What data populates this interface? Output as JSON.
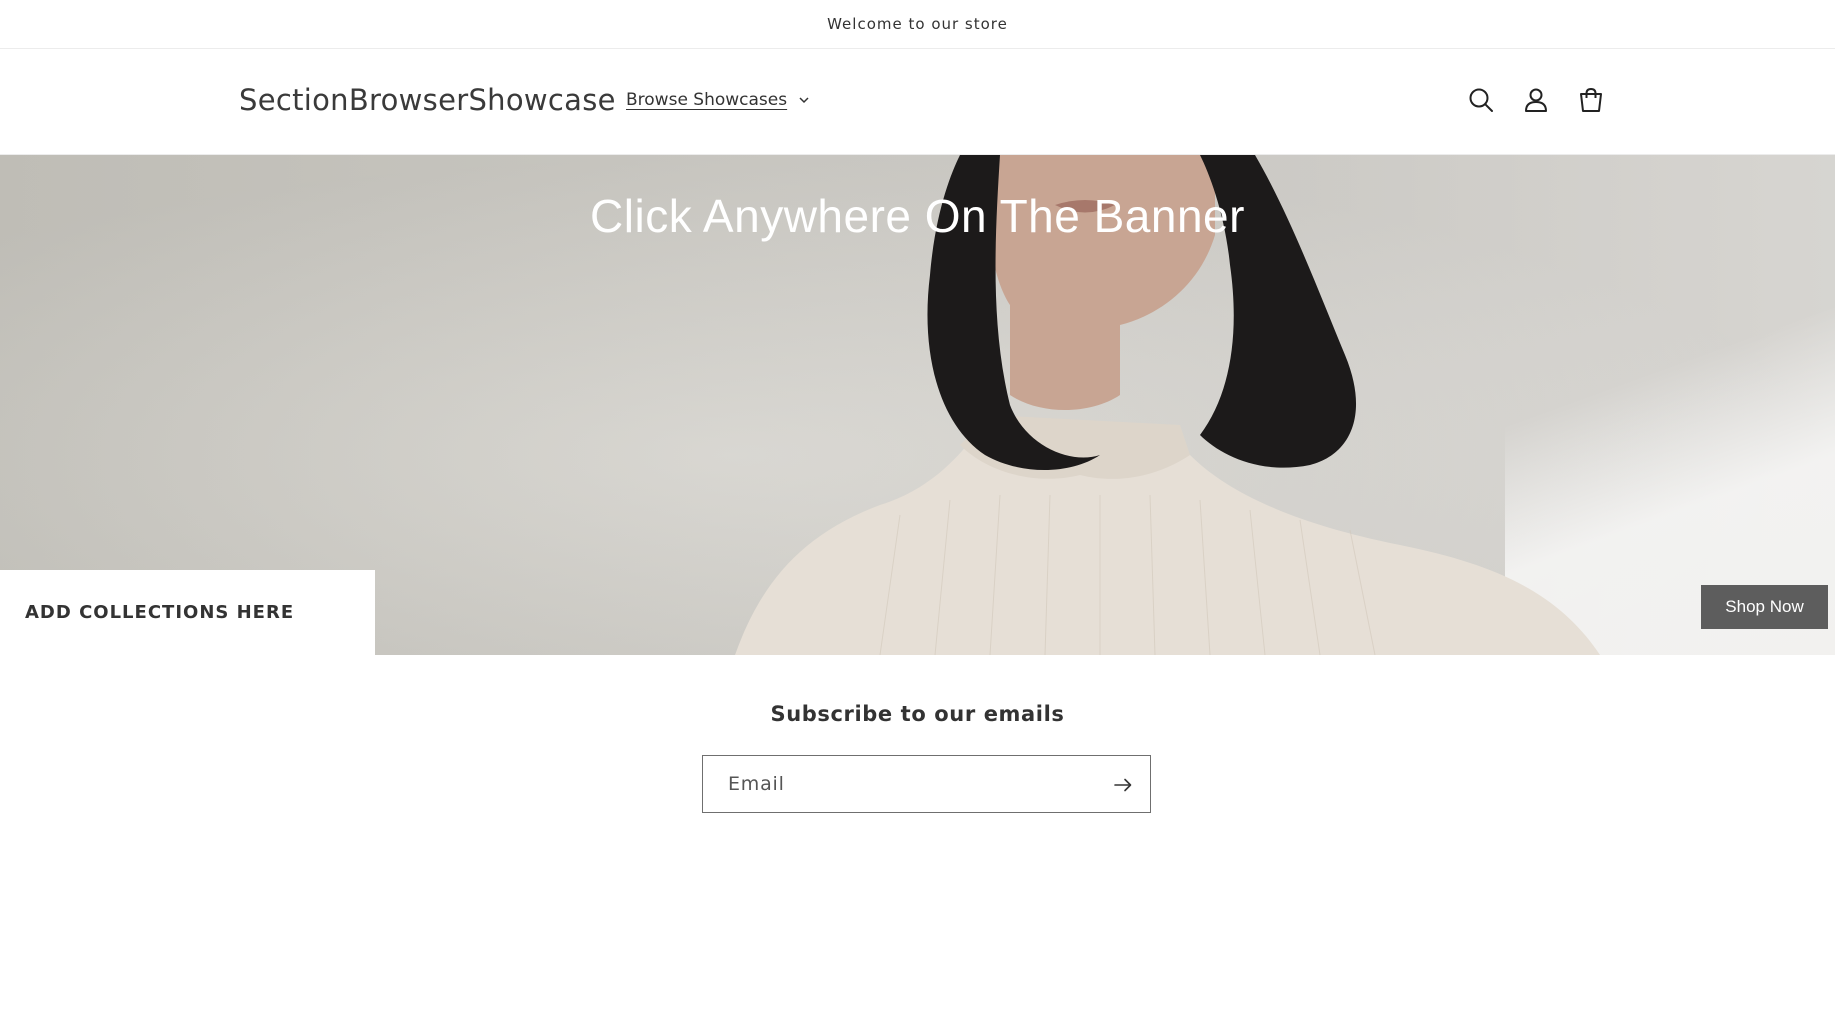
{
  "announcement": {
    "text": "Welcome to our store"
  },
  "header": {
    "logo": "SectionBrowserShowcase",
    "nav": [
      {
        "label": "Browse Showcases",
        "icon": "chevron-down-icon"
      }
    ],
    "icons": [
      "search-icon",
      "account-icon",
      "cart-icon"
    ]
  },
  "banner": {
    "heading": "Click Anywhere On The Banner",
    "collections_label": "ADD COLLECTIONS HERE",
    "cta_label": "Shop Now"
  },
  "newsletter": {
    "title": "Subscribe to our emails",
    "email_placeholder": "Email",
    "email_value": "",
    "submit_icon": "arrow-right-icon"
  },
  "colors": {
    "cta_background": "#5d5d5d",
    "text": "#333333",
    "border": "#6f6f6f"
  }
}
